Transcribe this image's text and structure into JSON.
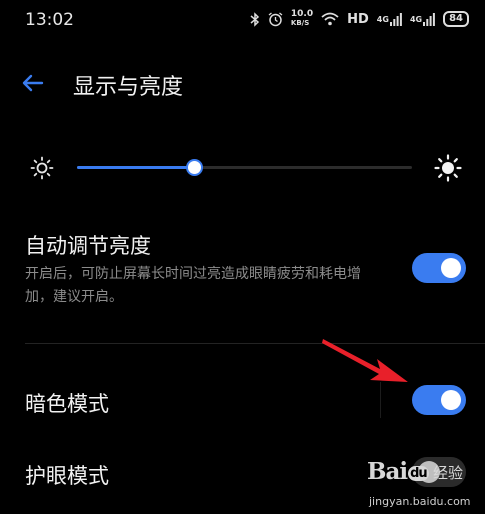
{
  "status_bar": {
    "time": "13:02",
    "net_speed_value": "10.0",
    "net_speed_unit": "KB/S",
    "hd_label": "HD",
    "signal_1_label": "4G",
    "signal_2_label": "4G",
    "battery": "84"
  },
  "header": {
    "title": "显示与亮度"
  },
  "brightness": {
    "level_fraction": 0.35
  },
  "auto_brightness": {
    "title": "自动调节亮度",
    "description": "开启后，可防止屏幕长时间过亮造成眼睛疲劳和耗电增加，建议开启。",
    "enabled": true
  },
  "dark_mode": {
    "title": "暗色模式",
    "enabled": true
  },
  "eye_comfort": {
    "title": "护眼模式"
  },
  "watermark": {
    "brand_left": "Bai",
    "brand_du": "du",
    "brand_jingyan": "经验",
    "url": "jingyan.baidu.com"
  },
  "colors": {
    "accent": "#3a7cf0",
    "arrow": "#e8202a",
    "background": "#000000"
  }
}
